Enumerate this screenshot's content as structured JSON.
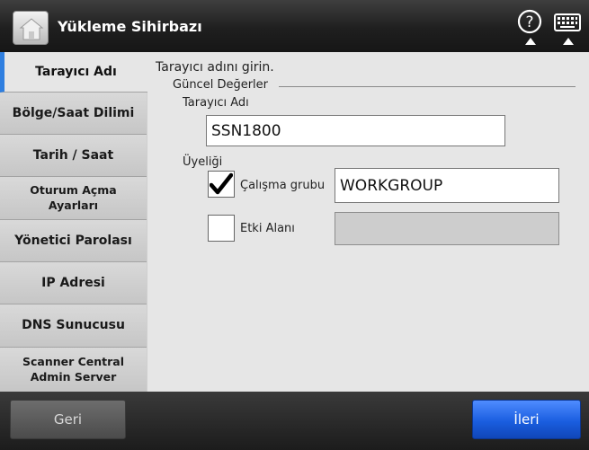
{
  "titlebar": {
    "title": "Yükleme Sihirbazı",
    "home_icon": "home-icon",
    "help_icon": "question-circle-icon",
    "keyboard_icon": "keyboard-icon"
  },
  "sidebar": {
    "items": [
      {
        "label": "Tarayıcı Adı",
        "active": true
      },
      {
        "label": "Bölge/Saat Dilimi"
      },
      {
        "label": "Tarih / Saat"
      },
      {
        "label": "Oturum Açma Ayarları"
      },
      {
        "label": "Yönetici Parolası"
      },
      {
        "label": "IP Adresi"
      },
      {
        "label": "DNS Sunucusu"
      },
      {
        "label": "Scanner Central Admin Server"
      }
    ]
  },
  "main": {
    "instruction": "Tarayıcı adını girin.",
    "group_title": "Güncel Değerler",
    "scanner_name_label": "Tarayıcı Adı",
    "scanner_name_value": "SSN1800",
    "membership_label": "Üyeliği",
    "workgroup": {
      "label": "Çalışma grubu",
      "checked": true,
      "value": "WORKGROUP"
    },
    "domain": {
      "label": "Etki Alanı",
      "checked": false,
      "value": ""
    }
  },
  "footer": {
    "back_label": "Geri",
    "next_label": "İleri"
  },
  "colors": {
    "accent": "#2f7fe0",
    "next_button": "#1a5ee0"
  }
}
